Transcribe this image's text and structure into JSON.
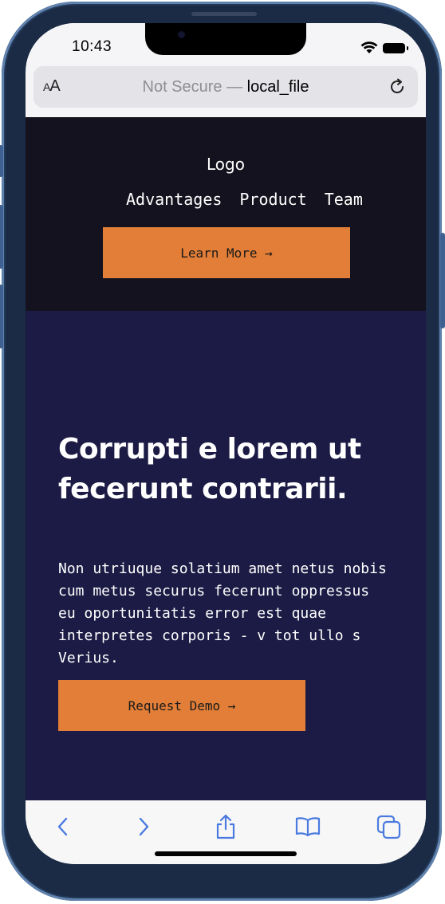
{
  "status_bar": {
    "time": "10:43"
  },
  "browser": {
    "text_size_label": "AA",
    "security_text": "Not Secure —",
    "url": "local_file",
    "accent_color": "#4a7ae0"
  },
  "site": {
    "logo": "Logo",
    "nav": [
      "Advantages",
      "Product",
      "Team"
    ],
    "cta_primary": "Learn More →",
    "headline": "Corrupti e lorem ut fecerunt contrarii.",
    "body": "Non utriuque solatium amet netus nobis cum metus securus fecerunt oppressus eu oportunitatis error est quae interpretes corporis - v tot ullo s Verius.",
    "cta_secondary": "Request Demo →",
    "colors": {
      "header_bg": "#14121e",
      "hero_bg": "#1c1b45",
      "button_bg": "#e27e37"
    }
  },
  "toolbar": {
    "icons": [
      "back-icon",
      "forward-icon",
      "share-icon",
      "bookmarks-icon",
      "tabs-icon"
    ]
  }
}
